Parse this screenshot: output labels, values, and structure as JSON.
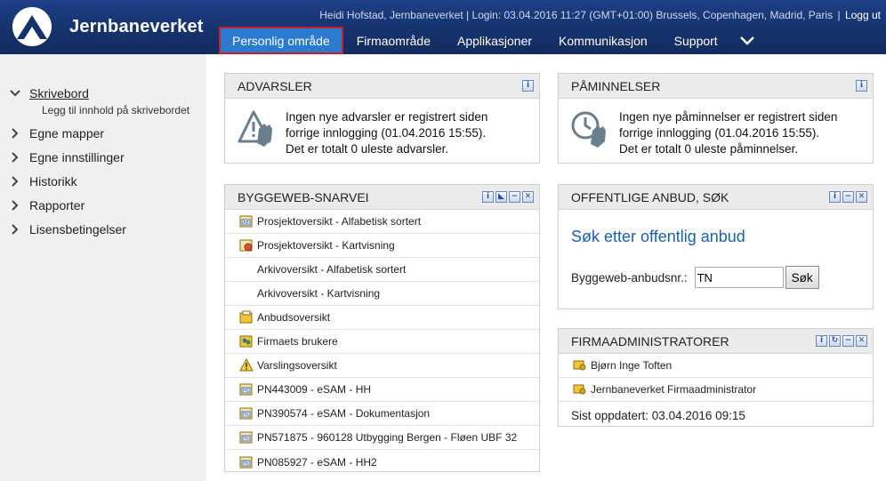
{
  "header": {
    "brand": "Jernbaneverket",
    "user_info": "Heidi Hofstad, Jernbaneverket | Login: 03.04.2016 11:27 (GMT+01:00) Brussels, Copenhagen, Madrid, Paris",
    "separator": "|",
    "logout": "Logg ut",
    "nav": [
      {
        "label": "Personlig område",
        "active": true
      },
      {
        "label": "Firmaområde"
      },
      {
        "label": "Applikasjoner"
      },
      {
        "label": "Kommunikasjon"
      },
      {
        "label": "Support"
      }
    ]
  },
  "sidebar": {
    "items": [
      {
        "label": "Skrivebord",
        "expanded": true
      },
      {
        "label": "Egne mapper"
      },
      {
        "label": "Egne innstillinger"
      },
      {
        "label": "Historikk"
      },
      {
        "label": "Rapporter"
      },
      {
        "label": "Lisensbetingelser"
      }
    ],
    "sub_item": "Legg til innhold på skrivebordet"
  },
  "advarsler": {
    "title": "ADVARSLER",
    "line1": "Ingen nye advarsler er registrert siden",
    "line2": "forrige innlogging (01.04.2016 15:55).",
    "line3": "Det er totalt 0 uleste advarsler."
  },
  "paminnelser": {
    "title": "PÅMINNELSER",
    "line1": "Ingen nye påminnelser er registrert siden",
    "line2": "forrige innlogging (01.04.2016 15:55).",
    "line3": "Det er totalt 0 uleste påminnelser."
  },
  "snarvei": {
    "title": "BYGGEWEB-SNARVEI",
    "rows": [
      {
        "label": "Prosjektoversikt - Alfabetisk sortert",
        "icon": "project-list-icon"
      },
      {
        "label": "Prosjektoversikt - Kartvisning",
        "icon": "project-map-icon"
      },
      {
        "label": "Arkivoversikt - Alfabetisk sortert",
        "icon": ""
      },
      {
        "label": "Arkivoversikt - Kartvisning",
        "icon": ""
      },
      {
        "label": "Anbudsoversikt",
        "icon": "tender-icon"
      },
      {
        "label": "Firmaets brukere",
        "icon": "users-icon"
      },
      {
        "label": "Varslingsoversikt",
        "icon": "warning-icon"
      },
      {
        "label": "PN443009 - eSAM - HH",
        "icon": "project-icon"
      },
      {
        "label": "PN390574 - eSAM - Dokumentasjon",
        "icon": "project-icon"
      },
      {
        "label": "PN571875 - 960128 Utbygging Bergen - Fløen UBF 32",
        "icon": "project-icon"
      },
      {
        "label": "PN085927 - eSAM - HH2",
        "icon": "project-icon"
      }
    ]
  },
  "anbud": {
    "title": "OFFENTLIGE ANBUD, SØK",
    "link": "Søk etter offentlig anbud",
    "field_label": "Byggeweb-anbudsnr.:",
    "field_value": "TN",
    "button": "Søk"
  },
  "firmaadmin": {
    "title": "FIRMAADMINISTRATORER",
    "rows": [
      "Bjørn Inge Toften",
      "Jernbaneverket Firmaadministrator"
    ],
    "updated": "Sist oppdatert: 03.04.2016 09:15"
  },
  "colors": {
    "header_bg": "#16326c",
    "active_tab": "#2a7bd0",
    "active_border": "#c8202a",
    "link": "#1a5fb0",
    "sidebar_bg": "#f0f0f0",
    "panel_head": "#ebebeb"
  }
}
